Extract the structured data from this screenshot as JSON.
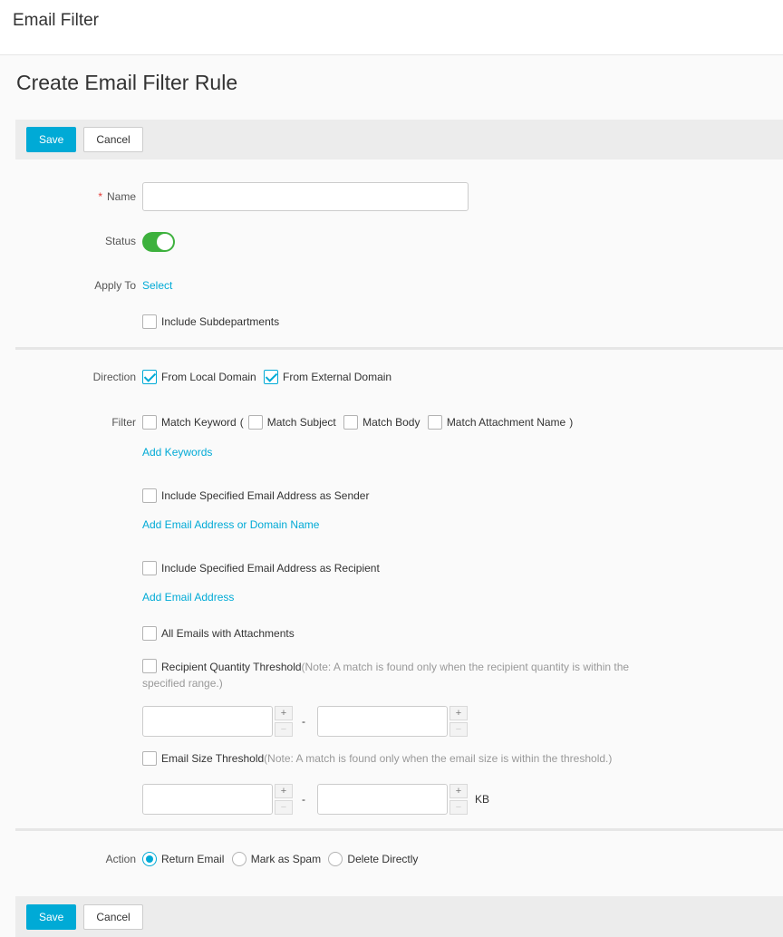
{
  "header": {
    "title": "Email Filter"
  },
  "page": {
    "title": "Create Email Filter Rule"
  },
  "toolbar": {
    "save_label": "Save",
    "cancel_label": "Cancel"
  },
  "form": {
    "name_label": "Name",
    "name_value": "",
    "status_label": "Status",
    "status_on": true,
    "apply_to_label": "Apply To",
    "apply_to_link": "Select",
    "include_subdepartments": "Include Subdepartments",
    "direction_label": "Direction",
    "direction_local": "From Local Domain",
    "direction_external": "From External Domain",
    "filter_label": "Filter",
    "match_keyword": "Match Keyword",
    "paren_open": "(",
    "match_subject": "Match Subject",
    "match_body": "Match Body",
    "match_attachment": "Match Attachment Name",
    "paren_close": ")",
    "add_keywords": "Add Keywords",
    "include_sender": "Include Specified Email Address as Sender",
    "add_sender": "Add Email Address or Domain Name",
    "include_recipient": "Include Specified Email Address as Recipient",
    "add_recipient": "Add Email Address",
    "all_attachments": "All Emails with Attachments",
    "recipient_threshold": "Recipient Quantity Threshold",
    "recipient_note": "(Note: A match is found only when the recipient quantity is within the specified range.)",
    "size_threshold": "Email Size Threshold",
    "size_note": "(Note: A match is found only when the email size is within the threshold.)",
    "range_dash": "-",
    "size_unit": "KB",
    "plus": "+",
    "minus": "−",
    "action_label": "Action",
    "action_return": "Return Email",
    "action_spam": "Mark as Spam",
    "action_delete": "Delete Directly"
  },
  "colors": {
    "accent": "#00aad6",
    "toggle_on": "#3db13d",
    "required": "#e53935"
  }
}
